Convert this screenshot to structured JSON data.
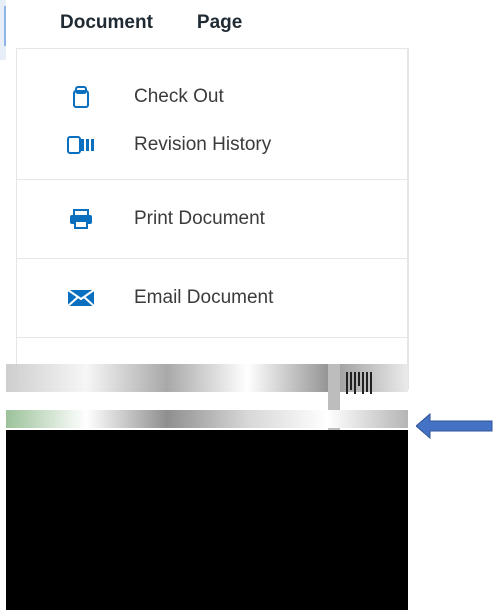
{
  "tabs": {
    "document": "Document",
    "page": "Page"
  },
  "menu": {
    "items": [
      {
        "label": "Check Out",
        "icon": "checkout-icon"
      },
      {
        "label": "Revision History",
        "icon": "revision-history-icon"
      },
      {
        "label": "Print Document",
        "icon": "printer-icon"
      },
      {
        "label": "Email Document",
        "icon": "email-icon"
      }
    ]
  },
  "colors": {
    "icon_blue": "#0b6fbf",
    "arrow_blue": "#4472c4",
    "divider": "#e6e6e6",
    "text": "#3b3b3b"
  }
}
